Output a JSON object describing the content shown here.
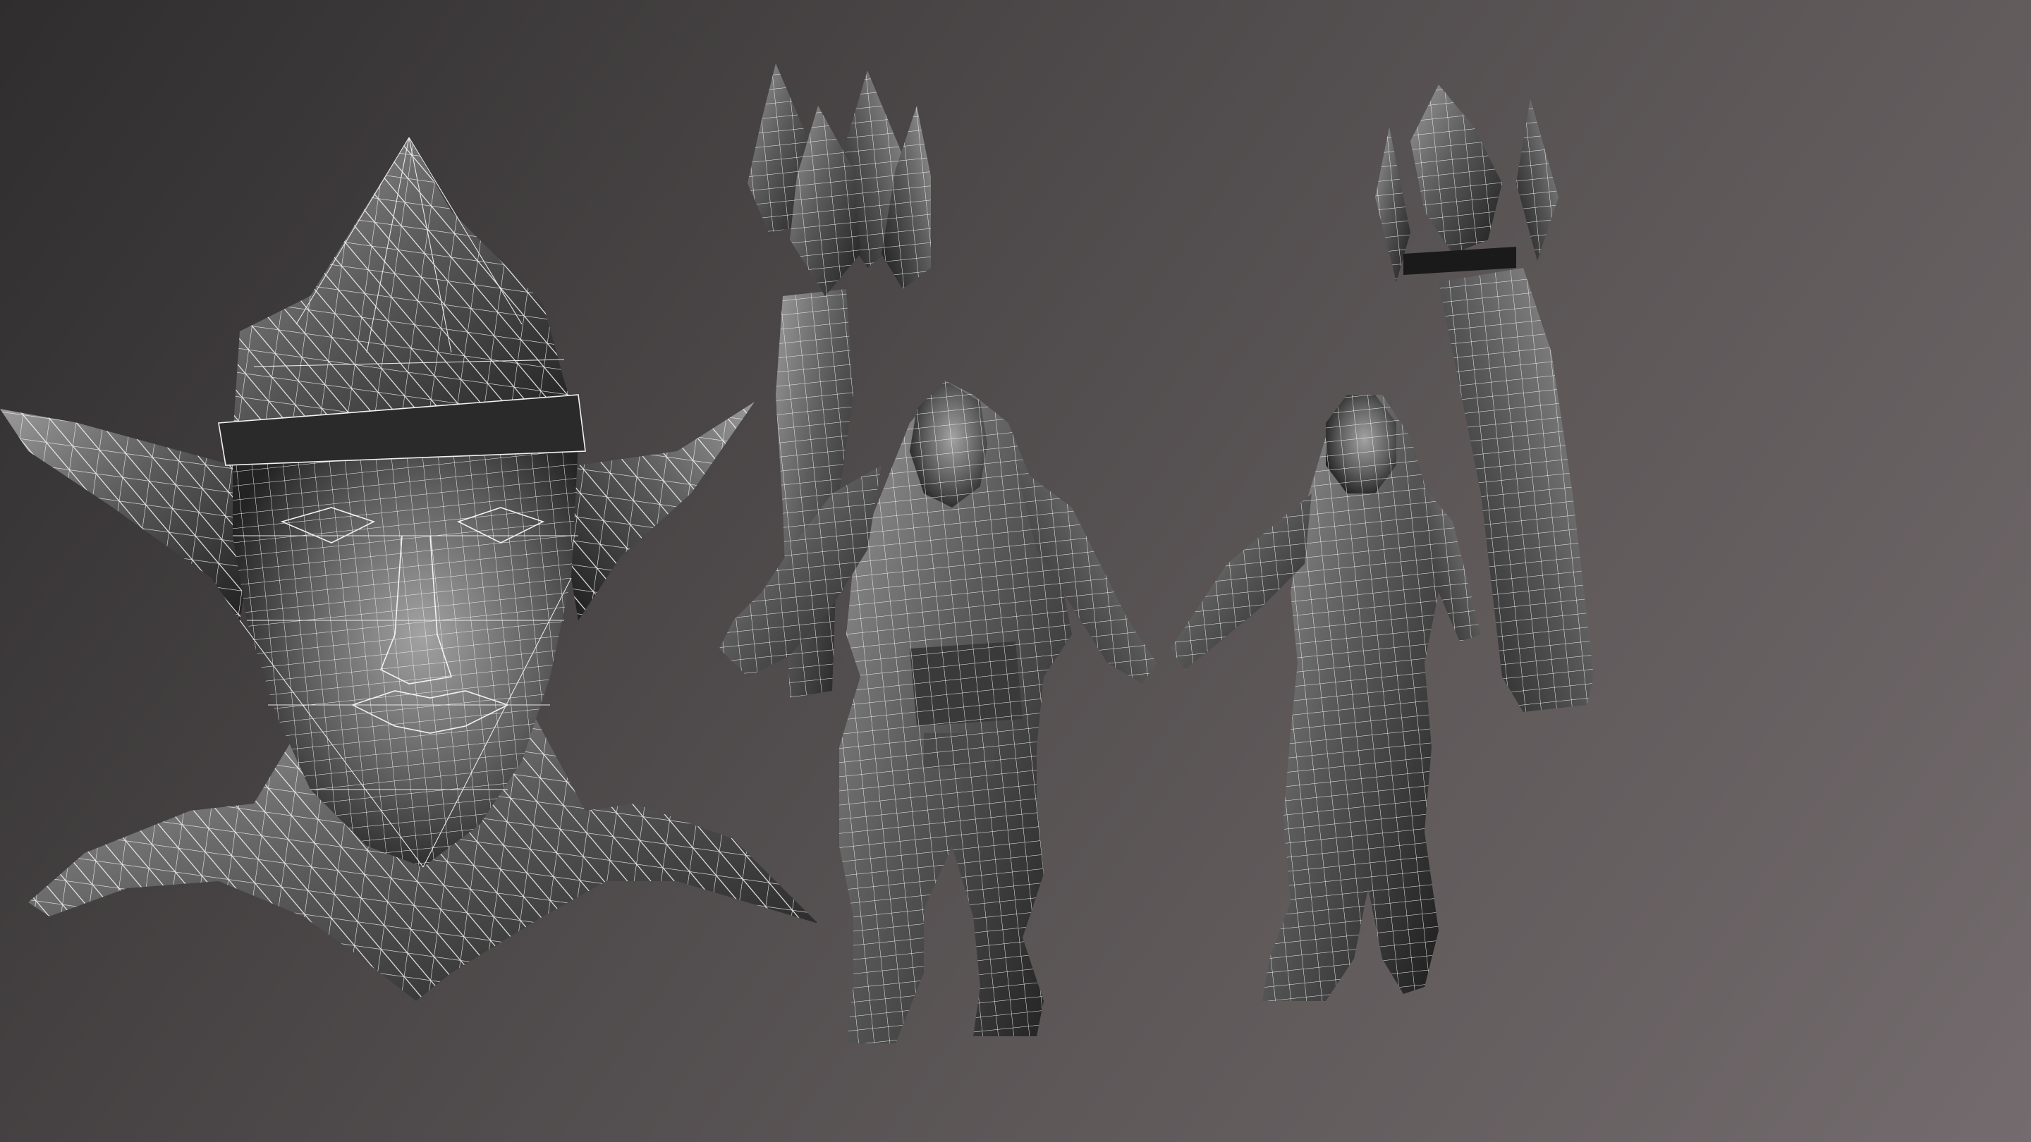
{
  "scene": {
    "subject_views": [
      {
        "name": "head-closeup"
      },
      {
        "name": "full-body-front"
      },
      {
        "name": "full-body-back"
      }
    ],
    "render_style": "wireframe-on-shaded",
    "colors": {
      "background_dark": "#2f2d2e",
      "background_light": "#736b6d",
      "mesh_dark": "#1c1c1c",
      "mesh_light": "#8a8a8a",
      "wire": "#f2f2f2"
    }
  }
}
